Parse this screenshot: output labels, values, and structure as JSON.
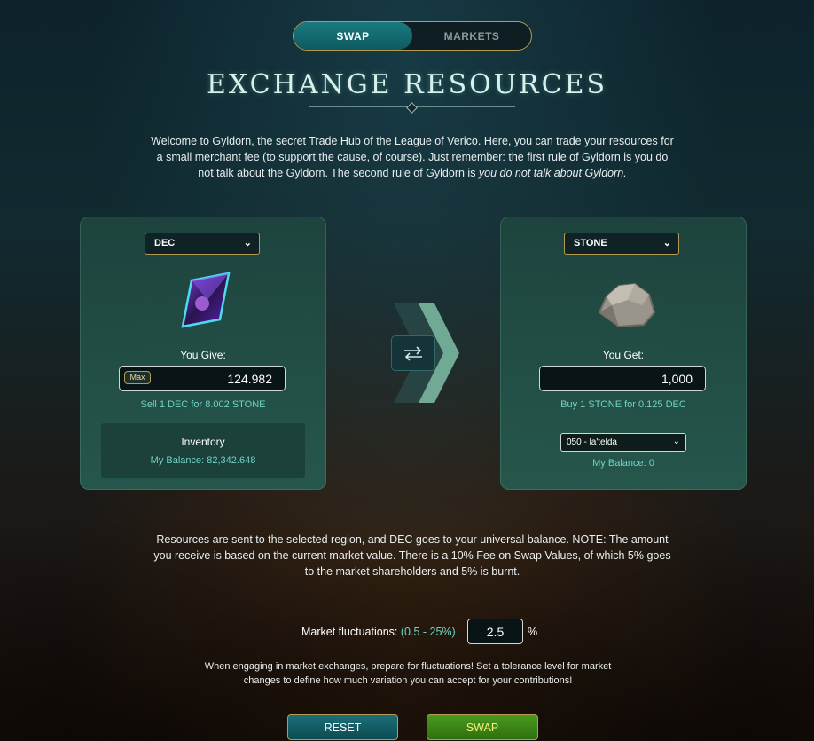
{
  "tabs": {
    "swap": "SWAP",
    "markets": "MARKETS"
  },
  "title": "EXCHANGE RESOURCES",
  "intro": {
    "text": "Welcome to Gyldorn, the secret Trade Hub of the League of Verico. Here, you can trade your resources for a small merchant fee (to support the cause, of course). Just remember: the first rule of Gyldorn is you do not talk about the Gyldorn. The second rule of Gyldorn is ",
    "emphasis": "you do not talk about Gyldorn."
  },
  "give": {
    "token": "DEC",
    "label": "You Give:",
    "max_label": "Max",
    "amount": "124.982",
    "rate": "Sell 1 DEC for 8.002 STONE",
    "inventory_title": "Inventory",
    "balance": "My Balance: 82,342.648",
    "icon": "dec-crystal-icon"
  },
  "get": {
    "token": "STONE",
    "label": "You Get:",
    "amount": "1,000",
    "rate": "Buy 1 STONE for 0.125 DEC",
    "region": "050 - la'telda",
    "balance": "My Balance: 0",
    "icon": "stone-rock-icon"
  },
  "note": "Resources are sent to the selected region, and DEC goes to your universal balance. NOTE: The amount you receive is based on the current market value. There is a 10% Fee on Swap Values, of which 5% goes to the market shareholders and 5% is burnt.",
  "fluctuation": {
    "label": "Market fluctuations:",
    "range": "(0.5 - 25%)",
    "value": "2.5",
    "unit": "%"
  },
  "tip": "When engaging in market exchanges, prepare for fluctuations! Set a tolerance level for market changes to define how much variation you can accept for your contributions!",
  "buttons": {
    "reset": "RESET",
    "swap": "SWAP"
  },
  "colors": {
    "accent": "#6fd3c4",
    "gold_border": "#b59b52",
    "swap_green": "#4a9a1e",
    "teal": "#1a7a80"
  }
}
